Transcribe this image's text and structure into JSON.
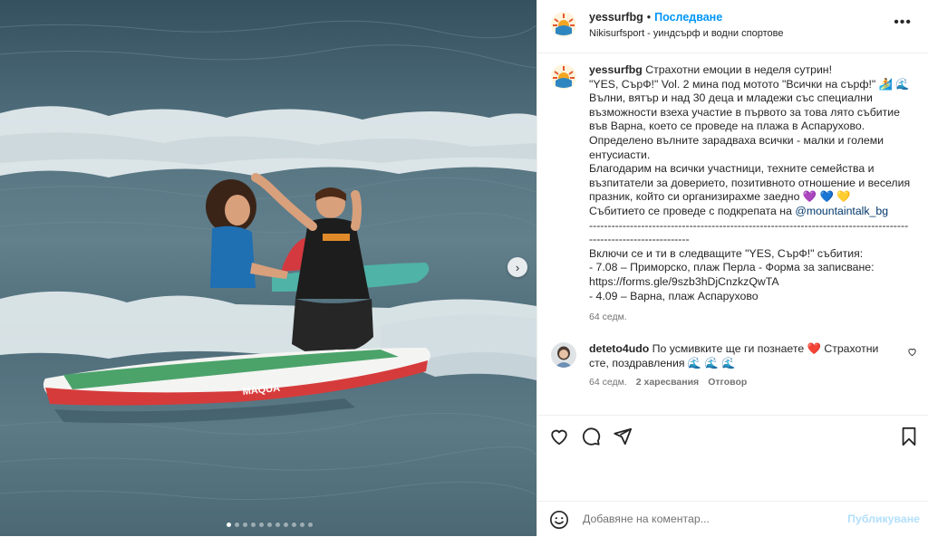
{
  "post": {
    "image_alt": "Children surfing on a paddle board in the sea",
    "carousel_dots": 11,
    "active_dot": 0
  },
  "header": {
    "username": "yessurfbg",
    "separator": "•",
    "follow_label": "Последване",
    "location": "Nikisurfsport - уиндсърф и водни спортове",
    "more_icon": "more-horizontal-icon"
  },
  "caption": {
    "username": "yessurfbg",
    "lines_before_mention": " Страхотни емоции в неделя сутрин!\n\"YES, СърФ!\" Vol. 2 мина под мотото \"Всички на сърф!\" 🏄 🌊\nВълни, вятър и над 30 деца и младежи със специални възможности взеха участие в първото за това лято събитие във Варна, което се проведе на плажа в Аспарухово.\nОпределено вълните зарадваха всички - малки и големи ентусиасти.\nБлагодарим на всички участници, техните семейства и възпитатели за доверието, позитивното отношение и веселия празник, който си организирахме заедно 💜 💙 💛\nСъбитието се проведе с подкрепата на ",
    "mention": "@mountaintalk_bg",
    "lines_after_mention": "\n-----------------------------------------------------------------------------------------------------------------\nВключи се и ти в следващите \"YES, СърФ!\" събития:\n- 7.08 – Приморско, плаж Перла - Форма за записване: https://forms.gle/9szb3hDjCnzkzQwTA\n- 4.09 – Варна, плаж Аспарухово",
    "time": "64 седм."
  },
  "comment": {
    "username": "deteto4udo",
    "text": " По усмивките ще ги познаете ❤️ Страхотни сте, поздравления 🌊 🌊 🌊",
    "time": "64 седм.",
    "likes": "2 харесвания",
    "reply_label": "Отговор"
  },
  "actions": {
    "like_icon": "heart-icon",
    "comment_icon": "comment-icon",
    "share_icon": "send-icon",
    "save_icon": "bookmark-icon"
  },
  "compose": {
    "placeholder": "Добавяне на коментар...",
    "publish_label": "Публикуване"
  },
  "colors": {
    "link_blue": "#0095f6",
    "mention_blue": "#00376b",
    "muted": "#737373",
    "publish_disabled": "#b2dffc",
    "heart_red": "#ed4956"
  }
}
